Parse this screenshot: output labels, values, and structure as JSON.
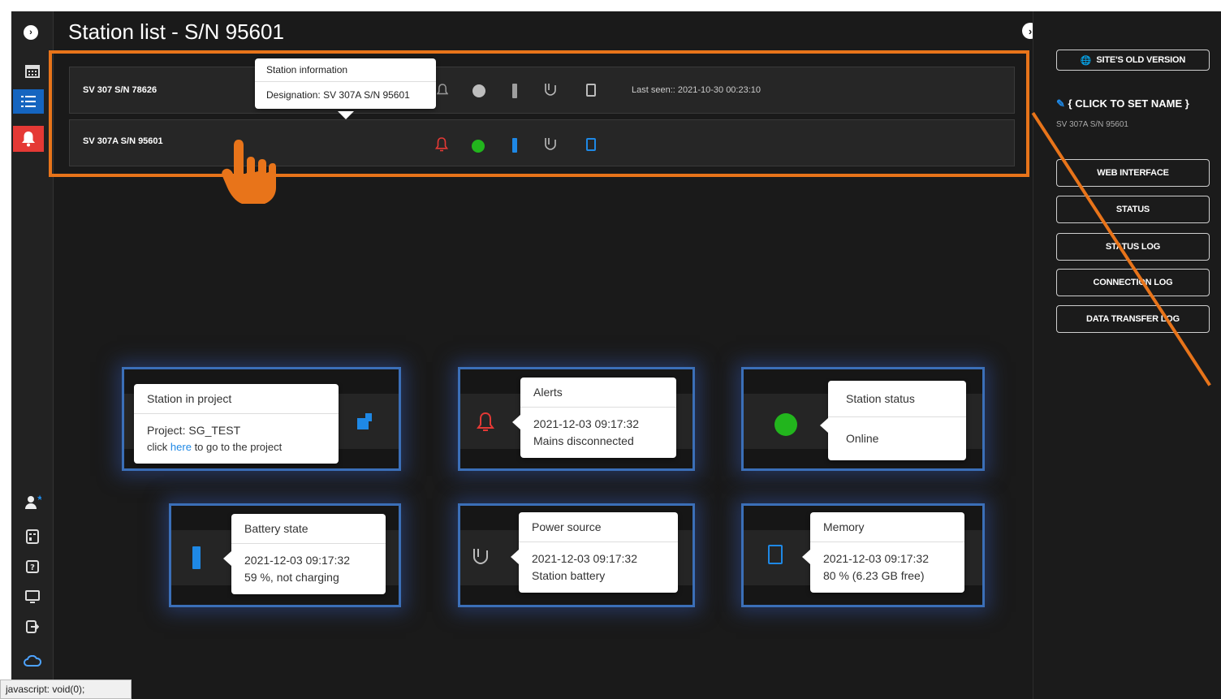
{
  "page": {
    "title": "Station list - S/N 95601"
  },
  "stations": [
    {
      "name": "SV 307 S/N 78626",
      "last_seen": "Last seen:: 2021-10-30 00:23:10"
    },
    {
      "name": "SV 307A S/N 95601",
      "last_seen": ""
    }
  ],
  "station_tooltip": {
    "header": "Station information",
    "label": "Designation:",
    "value": "SV 307A S/N 95601"
  },
  "right_panel": {
    "old_version": "SITE'S OLD VERSION",
    "name_placeholder": "{ CLICK TO SET NAME }",
    "serial": "SV 307A S/N 95601",
    "buttons": [
      "WEB INTERFACE",
      "STATUS",
      "STATUS LOG",
      "CONNECTION LOG",
      "DATA TRANSFER LOG"
    ]
  },
  "callouts": {
    "project": {
      "header": "Station in project",
      "line1_label": "Project:",
      "line1_value": "SG_TEST",
      "line2_a": "click",
      "line2_link": "here",
      "line2_b": "to go to the project"
    },
    "alerts": {
      "header": "Alerts",
      "line1": "2021-12-03 09:17:32",
      "line2": "Mains disconnected"
    },
    "status": {
      "header": "Station status",
      "line1": "Online"
    },
    "battery": {
      "header": "Battery state",
      "line1": "2021-12-03 09:17:32",
      "line2": "59 %, not charging"
    },
    "power": {
      "header": "Power source",
      "line1": "2021-12-03 09:17:32",
      "line2": "Station battery"
    },
    "memory": {
      "header": "Memory",
      "line1": "2021-12-03 09:17:32",
      "line2": "80 % (6.23 GB free)"
    }
  },
  "statusbar": {
    "text": "javascript: void(0);"
  },
  "colors": {
    "highlight": "#e8741a",
    "callout_border": "#3b6fb8",
    "online": "#22b51d",
    "alert_red": "#e53935",
    "blue_icon": "#1e88e5"
  }
}
